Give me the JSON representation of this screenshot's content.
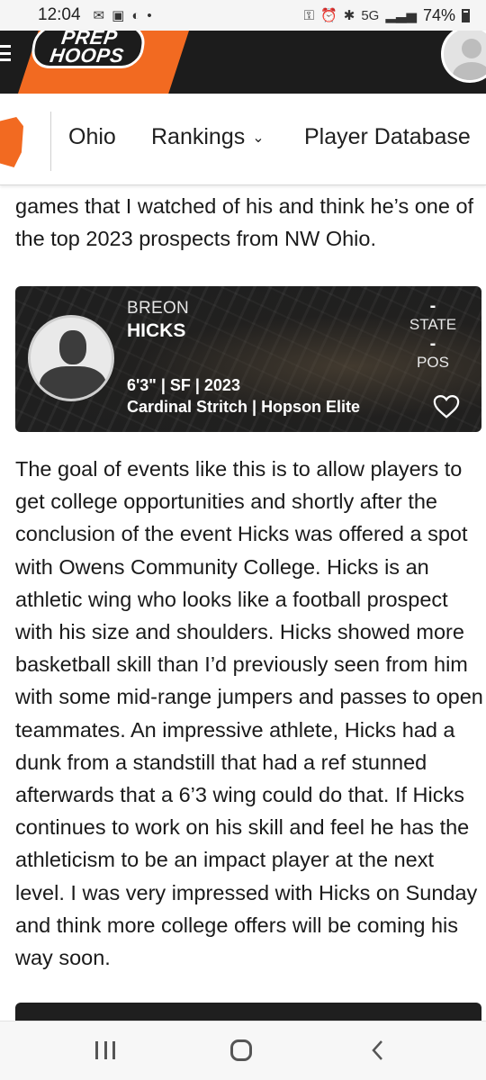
{
  "status_bar": {
    "time": "12:04",
    "battery": "74%",
    "icons": [
      "email-icon",
      "gallery-icon",
      "app-icon",
      "dot-icon",
      "key-icon",
      "alarm-icon",
      "bluetooth-icon",
      "5g-icon",
      "signal-icon",
      "battery-icon"
    ]
  },
  "header": {
    "logo_line1": "PREP",
    "logo_line2": "HOOPS",
    "brand_color": "#f26a21",
    "header_bg": "#1c1c1c"
  },
  "subnav": {
    "items": [
      {
        "label": "Ohio"
      },
      {
        "label": "Rankings",
        "has_dropdown": true
      },
      {
        "label": "Player Database"
      }
    ]
  },
  "article": {
    "paragraph1": "games that I watched of his and think he’s one of the top 2023 prospects from NW Ohio.",
    "paragraph2": "The goal of events like this is to allow players to get college opportunities and shortly after the conclusion of the event Hicks was offered a spot with Owens Community College. Hicks is an athletic wing who looks like a football prospect with his size and shoulders. Hicks showed more basketball skill than I’d previously seen from him with some mid-range jumpers and passes to open teammates. An impressive athlete, Hicks had a dunk from a standstill that had a ref stunned afterwards that a 6’3 wing could do that. If Hicks continues to work on his skill and feel he has the athleticism to be an impact player at the next level. I was very impressed with Hicks on Sunday and think more college offers will be coming his way soon."
  },
  "player_card": {
    "first_name": "BREON",
    "last_name": "HICKS",
    "attributes": "6'3\"  |  SF  |  2023",
    "school_team": "Cardinal Stritch  |  Hopson Elite",
    "state_rank": "-",
    "state_label": "STATE",
    "pos_rank": "-",
    "pos_label": "POS"
  }
}
